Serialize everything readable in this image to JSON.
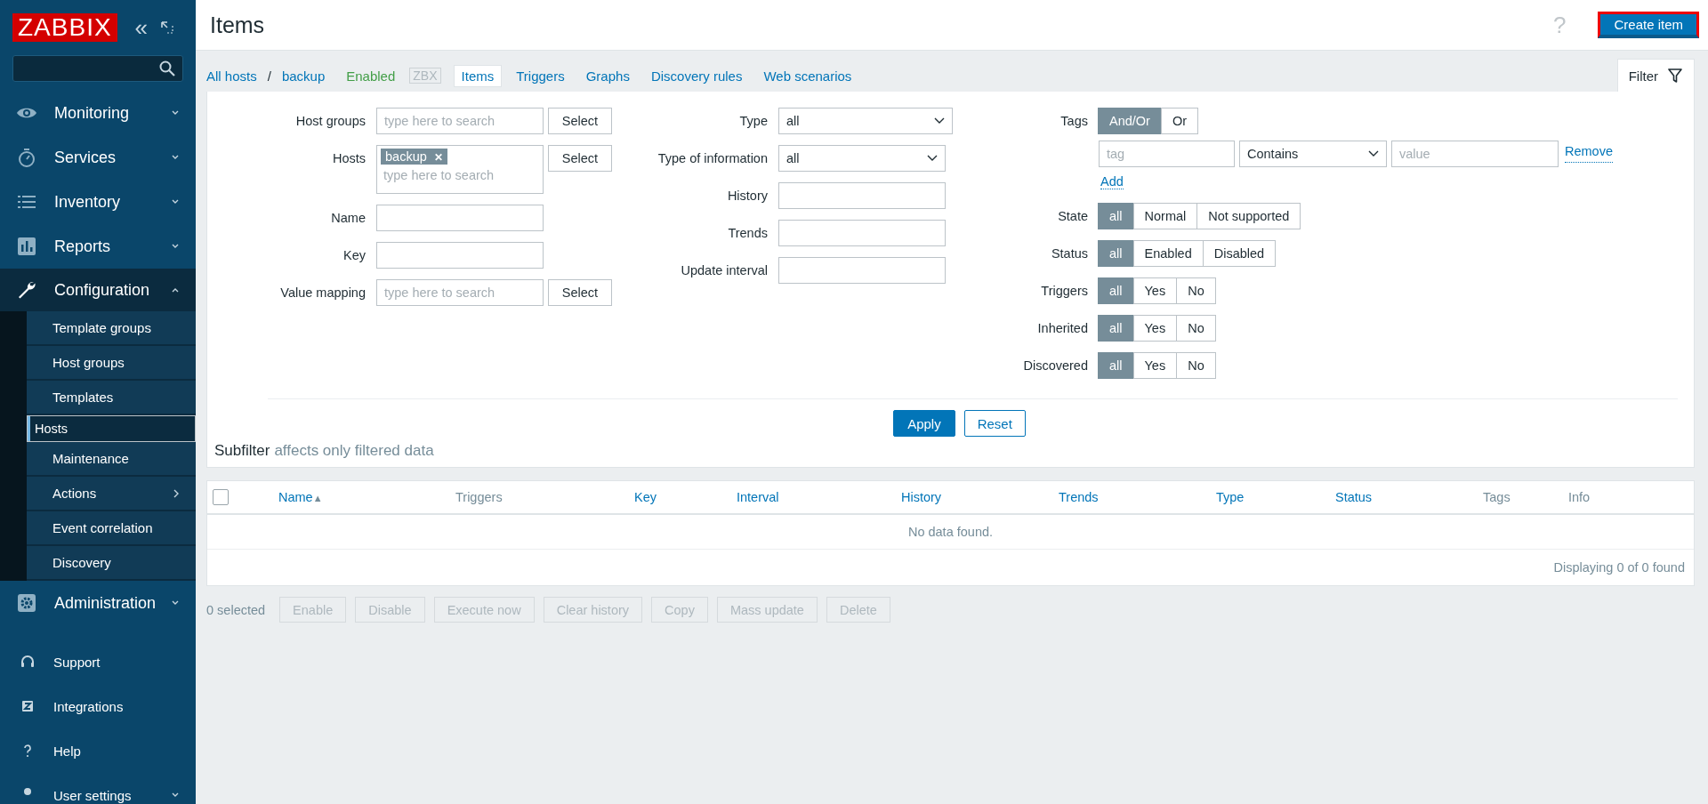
{
  "sidebar": {
    "logo": "ZABBIX",
    "collapse": "«",
    "menu": [
      {
        "label": "Monitoring",
        "expanded": false
      },
      {
        "label": "Services",
        "expanded": false
      },
      {
        "label": "Inventory",
        "expanded": false
      },
      {
        "label": "Reports",
        "expanded": false
      },
      {
        "label": "Configuration",
        "expanded": true,
        "children": [
          {
            "label": "Template groups",
            "selected": false,
            "submenu": false
          },
          {
            "label": "Host groups",
            "selected": false,
            "submenu": false
          },
          {
            "label": "Templates",
            "selected": false,
            "submenu": false
          },
          {
            "label": "Hosts",
            "selected": true,
            "submenu": false
          },
          {
            "label": "Maintenance",
            "selected": false,
            "submenu": false
          },
          {
            "label": "Actions",
            "selected": false,
            "submenu": true
          },
          {
            "label": "Event correlation",
            "selected": false,
            "submenu": false
          },
          {
            "label": "Discovery",
            "selected": false,
            "submenu": false
          }
        ]
      },
      {
        "label": "Administration",
        "expanded": false
      }
    ],
    "bottom": [
      {
        "label": "Support",
        "expandable": false
      },
      {
        "label": "Integrations",
        "expandable": false
      },
      {
        "label": "Help",
        "expandable": false
      },
      {
        "label": "User settings",
        "expandable": true
      }
    ]
  },
  "header": {
    "title": "Items",
    "help": "?",
    "create_button": "Create item"
  },
  "nav": [
    {
      "kind": "link",
      "label": "All hosts"
    },
    {
      "kind": "separator",
      "label": "/"
    },
    {
      "kind": "link",
      "label": "backup"
    },
    {
      "kind": "status",
      "label": "Enabled"
    },
    {
      "kind": "badge",
      "label": "ZBX"
    },
    {
      "kind": "tab",
      "label": "Items"
    },
    {
      "kind": "link",
      "label": "Triggers"
    },
    {
      "kind": "link",
      "label": "Graphs"
    },
    {
      "kind": "link",
      "label": "Discovery rules"
    },
    {
      "kind": "link",
      "label": "Web scenarios"
    }
  ],
  "filter": {
    "tab": "Filter",
    "left": [
      {
        "kind": "search",
        "label": "Host groups",
        "placeholder": "type here to search",
        "button": "Select"
      },
      {
        "kind": "multi",
        "label": "Hosts",
        "chips": [
          "backup"
        ],
        "chip_remove": "✕",
        "placeholder": "type here to search",
        "button": "Select"
      },
      {
        "kind": "input",
        "label": "Name"
      },
      {
        "kind": "input",
        "label": "Key"
      },
      {
        "kind": "search",
        "label": "Value mapping",
        "placeholder": "type here to search",
        "button": "Select"
      }
    ],
    "middle": [
      {
        "kind": "select",
        "label": "Type",
        "value": "all"
      },
      {
        "kind": "select",
        "label": "Type of information",
        "value": "all"
      },
      {
        "kind": "input",
        "label": "History"
      },
      {
        "kind": "input",
        "label": "Trends"
      },
      {
        "kind": "input",
        "label": "Update interval"
      }
    ],
    "tags": {
      "label": "Tags",
      "options": [
        {
          "label": "And/Or",
          "selected": true
        },
        {
          "label": "Or",
          "selected": false
        }
      ],
      "tag_placeholder": "tag",
      "operator": "Contains",
      "value_placeholder": "value",
      "remove": "Remove",
      "add": "Add"
    },
    "segments": [
      {
        "label": "State",
        "options": [
          {
            "label": "all",
            "selected": true
          },
          {
            "label": "Normal",
            "selected": false
          },
          {
            "label": "Not supported",
            "selected": false
          }
        ]
      },
      {
        "label": "Status",
        "options": [
          {
            "label": "all",
            "selected": true
          },
          {
            "label": "Enabled",
            "selected": false
          },
          {
            "label": "Disabled",
            "selected": false
          }
        ]
      },
      {
        "label": "Triggers",
        "options": [
          {
            "label": "all",
            "selected": true
          },
          {
            "label": "Yes",
            "selected": false
          },
          {
            "label": "No",
            "selected": false
          }
        ]
      },
      {
        "label": "Inherited",
        "options": [
          {
            "label": "all",
            "selected": true
          },
          {
            "label": "Yes",
            "selected": false
          },
          {
            "label": "No",
            "selected": false
          }
        ]
      },
      {
        "label": "Discovered",
        "options": [
          {
            "label": "all",
            "selected": true
          },
          {
            "label": "Yes",
            "selected": false
          },
          {
            "label": "No",
            "selected": false
          }
        ]
      }
    ],
    "apply": "Apply",
    "reset": "Reset"
  },
  "subfilter": {
    "title": "Subfilter",
    "note": "affects only filtered data"
  },
  "table": {
    "checked": false,
    "columns": [
      {
        "label": "Name",
        "sortable": true,
        "sort": "▲"
      },
      {
        "label": "Triggers",
        "sortable": false
      },
      {
        "label": "Key",
        "sortable": true
      },
      {
        "label": "Interval",
        "sortable": true
      },
      {
        "label": "History",
        "sortable": true
      },
      {
        "label": "Trends",
        "sortable": true
      },
      {
        "label": "Type",
        "sortable": true
      },
      {
        "label": "Status",
        "sortable": true
      },
      {
        "label": "Tags",
        "sortable": false
      },
      {
        "label": "Info",
        "sortable": false
      }
    ],
    "empty": "No data found.",
    "footer": "Displaying 0 of 0 found"
  },
  "actions": {
    "selected": "0 selected",
    "buttons": [
      {
        "label": "Enable",
        "disabled": true
      },
      {
        "label": "Disable",
        "disabled": true
      },
      {
        "label": "Execute now",
        "disabled": true
      },
      {
        "label": "Clear history",
        "disabled": true
      },
      {
        "label": "Copy",
        "disabled": true
      },
      {
        "label": "Mass update",
        "disabled": true
      },
      {
        "label": "Delete",
        "disabled": true
      }
    ]
  }
}
